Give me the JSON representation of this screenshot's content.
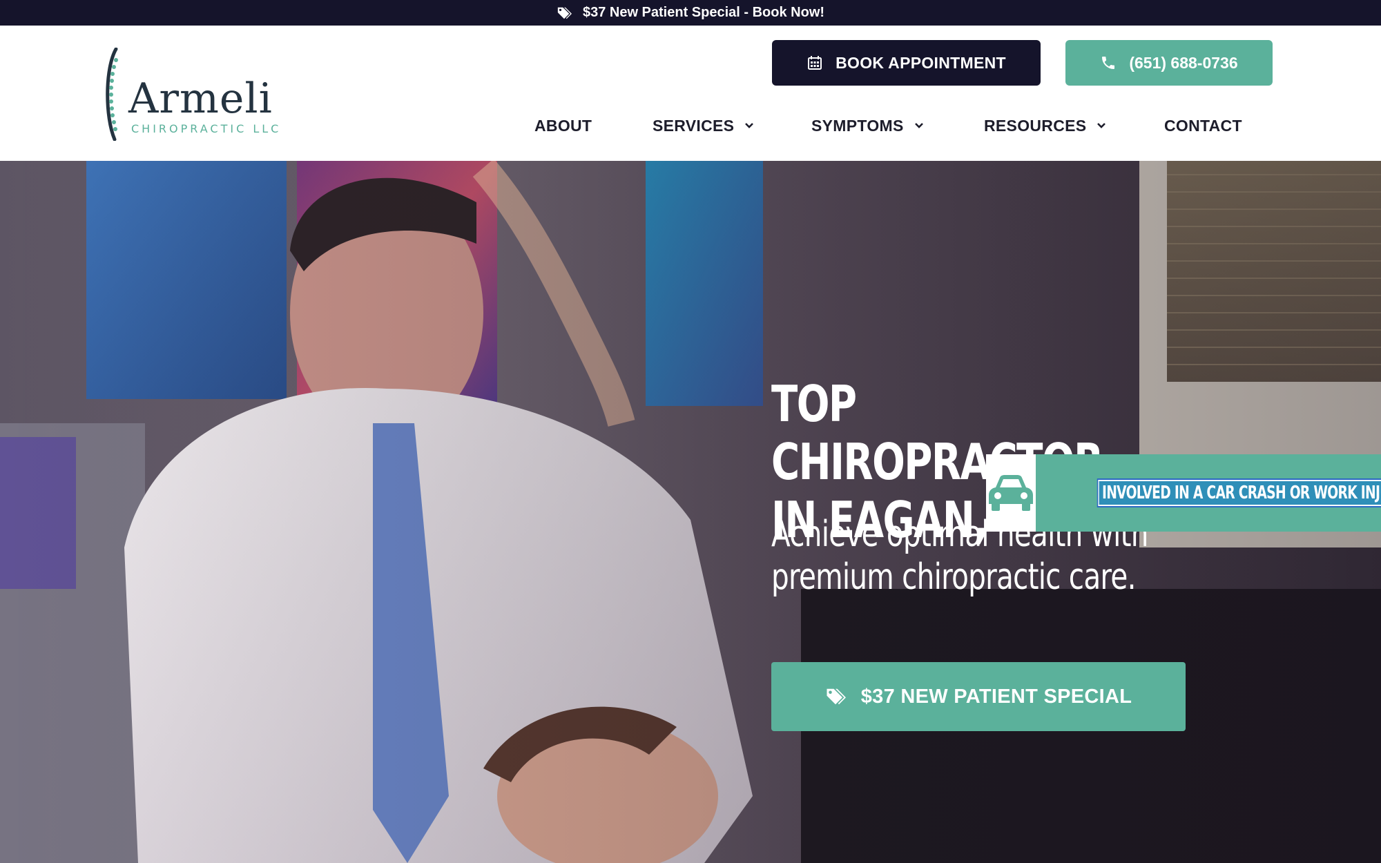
{
  "topbar": {
    "text": "$37 New Patient Special - Book Now!",
    "icon": "tags-icon"
  },
  "header": {
    "logo": {
      "name": "Armeli",
      "tagline": "CHIROPRACTIC LLC"
    },
    "book_button": {
      "label": "BOOK APPOINTMENT",
      "icon": "calendar-icon"
    },
    "phone_button": {
      "label": "(651) 688-0736",
      "icon": "phone-icon"
    },
    "nav": [
      {
        "label": "ABOUT",
        "dropdown": false
      },
      {
        "label": "SERVICES",
        "dropdown": true
      },
      {
        "label": "SYMPTOMS",
        "dropdown": true
      },
      {
        "label": "RESOURCES",
        "dropdown": true
      },
      {
        "label": "CONTACT",
        "dropdown": false
      }
    ]
  },
  "hero": {
    "title": "TOP CHIROPRACTOR IN EAGAN,",
    "subtitle": "Achieve optimal health with premium chiropractic care.",
    "cta_label": "$37 NEW PATIENT SPECIAL",
    "cta_icon": "tags-icon"
  },
  "crash_flyout": {
    "label": "INVOLVED IN A CAR CRASH OR WORK INJURY?",
    "icon": "car-icon"
  },
  "colors": {
    "navy": "#15142b",
    "teal": "#5bb19b",
    "text_dark": "#1d1d2b",
    "logo_dark": "#243340"
  }
}
